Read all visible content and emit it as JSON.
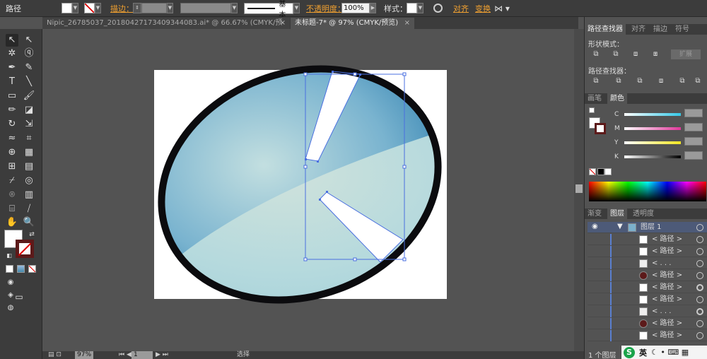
{
  "control_bar": {
    "object_type": "路径",
    "stroke_label": "描边：",
    "stroke_profile": "基本",
    "opacity_label": "不透明度：",
    "opacity_value": "100%",
    "style_label": "样式：",
    "align_label": "对齐",
    "transform_label": "变换"
  },
  "tabs": [
    {
      "label": "Nipic_26785037_20180427173409344083.ai* @ 66.67% (CMYK/预览)",
      "close": "×"
    },
    {
      "label": "未标题-7* @ 97% (CMYK/预览)",
      "close": "×"
    }
  ],
  "status": {
    "zoom": "97%",
    "page": "1",
    "tool": "选择"
  },
  "panels": {
    "pathfinder_tabs": [
      "路径查找器",
      "对齐",
      "描边",
      "符号"
    ],
    "shape_modes_label": "形状模式：",
    "expand_label": "扩展",
    "pathfinders_label": "路径查找器：",
    "color_tabs": [
      "画笔",
      "颜色"
    ],
    "cmyk": [
      {
        "label": "C",
        "color": "#35c9e8"
      },
      {
        "label": "M",
        "color": "#e0379a"
      },
      {
        "label": "Y",
        "color": "#f2e622"
      },
      {
        "label": "K",
        "color": "#000000"
      }
    ],
    "layer_tabs": [
      "渐变",
      "图层",
      "透明度"
    ],
    "layer_name": "图层 1",
    "layer_items": [
      "< 路径 >",
      "< 路径 >",
      "< . . .",
      "< 路径 >",
      "< 路径 >",
      "< 路径 >",
      "< . . .",
      "< 路径 >",
      "< 路径 >"
    ],
    "layer_count": "1 个图层"
  },
  "ime": {
    "logo": "S",
    "lang": "英"
  },
  "colors": {
    "ellipse_stroke": "#0b0b0e",
    "gradient_dark": "#1f74a8",
    "gradient_light": "#c3dfe0",
    "selection": "#4a6fe0"
  }
}
